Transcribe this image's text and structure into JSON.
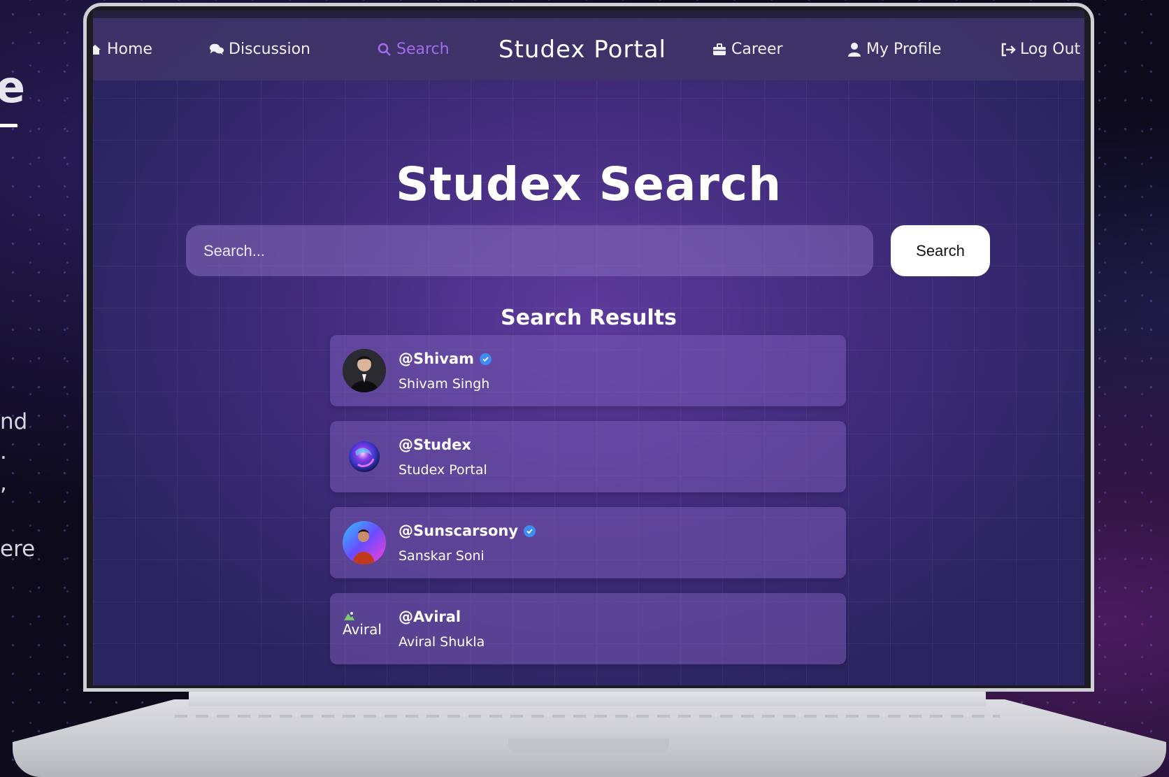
{
  "nav": {
    "home": "Home",
    "discussion": "Discussion",
    "search": "Search",
    "brand": "Studex Portal",
    "career": "Career",
    "profile": "My Profile",
    "logout": "Log Out"
  },
  "page": {
    "title": "Studex Search"
  },
  "search": {
    "placeholder": "Search...",
    "button_label": "Search"
  },
  "results": {
    "title": "Search Results",
    "items": [
      {
        "username": "@Shivam",
        "name": "Shivam Singh",
        "verified": true,
        "avatar": "person-photo"
      },
      {
        "username": "@Studex",
        "name": "Studex Portal",
        "verified": false,
        "avatar": "orb-logo"
      },
      {
        "username": "@Sunscarsony",
        "name": "Sanskar Soni",
        "verified": true,
        "avatar": "person-photo"
      },
      {
        "username": "@Aviral",
        "name": "Aviral Shukla",
        "verified": false,
        "avatar": "broken-image",
        "avatar_alt": "Aviral"
      }
    ]
  },
  "background_text": {
    "heading": "e",
    "lines": [
      "nd",
      ".",
      ",",
      "ere"
    ]
  },
  "colors": {
    "active_nav": "#a46bf0",
    "verified": "#3d8df2",
    "screen_bg": "#3d2a78"
  }
}
